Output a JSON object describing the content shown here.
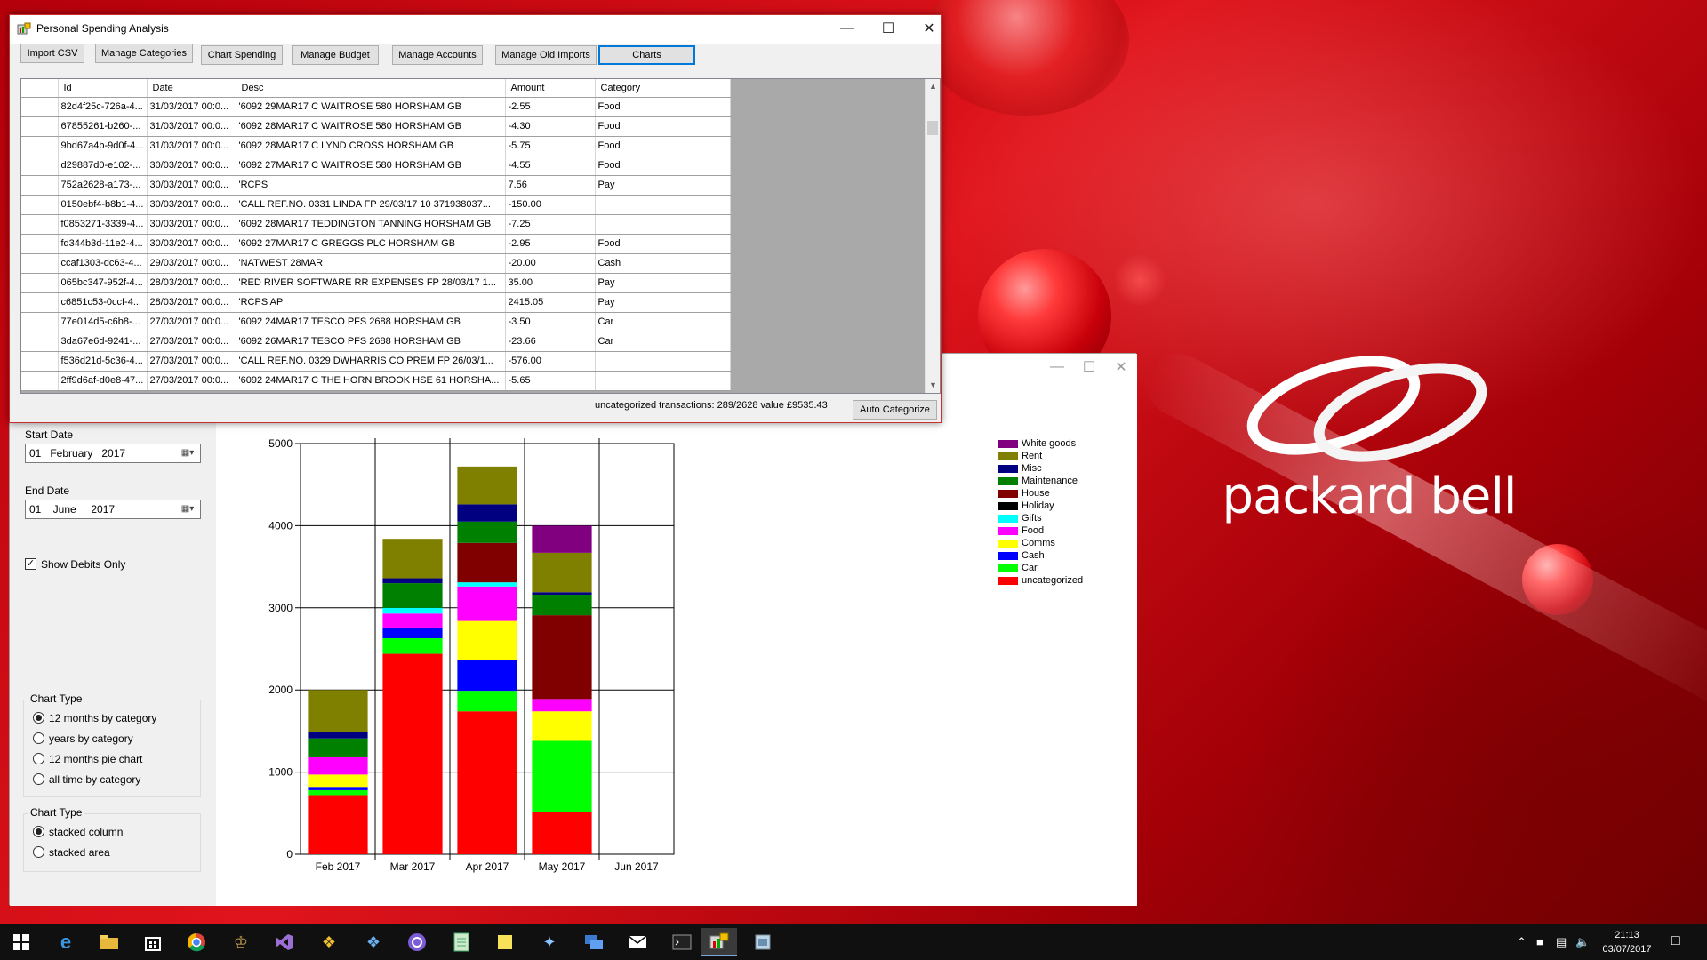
{
  "main_window": {
    "title": "Personal Spending Analysis",
    "toolbar": [
      "Import CSV",
      "Manage Categories",
      "Chart Spending",
      "Manage Budget",
      "Manage Accounts",
      "Manage Old Imports",
      "Charts"
    ],
    "grid": {
      "columns": [
        "",
        "Id",
        "Date",
        "Desc",
        "Amount",
        "Category"
      ],
      "rows": [
        [
          "82d4f25c-726a-4...",
          "31/03/2017 00:0...",
          "'6092 29MAR17 C  WAITROSE 580  HORSHAM GB",
          "-2.55",
          "Food"
        ],
        [
          "67855261-b260-...",
          "31/03/2017 00:0...",
          "'6092 28MAR17 C  WAITROSE 580  HORSHAM GB",
          "-4.30",
          "Food"
        ],
        [
          "9bd67a4b-9d0f-4...",
          "31/03/2017 00:0...",
          "'6092 28MAR17 C  LYND CROSS  HORSHAM GB",
          "-5.75",
          "Food"
        ],
        [
          "d29887d0-e102-...",
          "30/03/2017 00:0...",
          "'6092 27MAR17 C  WAITROSE 580  HORSHAM GB",
          "-4.55",
          "Food"
        ],
        [
          "752a2628-a173-...",
          "30/03/2017 00:0...",
          "'RCPS",
          "7.56",
          "Pay"
        ],
        [
          "0150ebf4-b8b1-4...",
          "30/03/2017 00:0...",
          "'CALL REF.NO. 0331  LINDA  FP 29/03/17 10  371938037...",
          "-150.00",
          ""
        ],
        [
          "f0853271-3339-4...",
          "30/03/2017 00:0...",
          "'6092 28MAR17  TEDDINGTON TANNING HORSHAM GB",
          "-7.25",
          ""
        ],
        [
          "fd344b3d-11e2-4...",
          "30/03/2017 00:0...",
          "'6092 27MAR17 C  GREGGS PLC  HORSHAM GB",
          "-2.95",
          "Food"
        ],
        [
          "ccaf1303-dc63-4...",
          "29/03/2017 00:0...",
          "'NATWEST 28MAR",
          "-20.00",
          "Cash"
        ],
        [
          "065bc347-952f-4...",
          "28/03/2017 00:0...",
          "'RED RIVER SOFTWARE RR EXPENSES  FP 28/03/17 1...",
          "35.00",
          "Pay"
        ],
        [
          "c6851c53-0ccf-4...",
          "28/03/2017 00:0...",
          "'RCPS AP",
          "2415.05",
          "Pay"
        ],
        [
          "77e014d5-c6b8-...",
          "27/03/2017 00:0...",
          "'6092 24MAR17  TESCO PFS 2688  HORSHAM GB",
          "-3.50",
          "Car"
        ],
        [
          "3da67e6d-9241-...",
          "27/03/2017 00:0...",
          "'6092 26MAR17  TESCO PFS 2688  HORSHAM GB",
          "-23.66",
          "Car"
        ],
        [
          "f536d21d-5c36-4...",
          "27/03/2017 00:0...",
          "'CALL REF.NO. 0329  DWHARRIS CO PREM  FP 26/03/1...",
          "-576.00",
          ""
        ],
        [
          "2ff9d6af-d0e8-47...",
          "27/03/2017 00:0...",
          "'6092 24MAR17 C  THE HORN BROOK HSE 61  HORSHA...",
          "-5.65",
          ""
        ]
      ]
    },
    "status": "uncategorized transactions: 289/2628 value £9535.43",
    "auto_categorize": "Auto Categorize"
  },
  "chart_window": {
    "start_date_label": "Start Date",
    "start_date": "01   February   2017",
    "end_date_label": "End Date",
    "end_date": "01    June     2017",
    "show_debits": "Show Debits Only",
    "show_debits_checked": true,
    "chart_type_group1": {
      "title": "Chart Type",
      "options": [
        "12 months by category",
        "years by category",
        "12 months pie chart",
        "all time by category"
      ],
      "selected": 0
    },
    "chart_type_group2": {
      "title": "Chart Type",
      "options": [
        "stacked column",
        "stacked area"
      ],
      "selected": 0
    }
  },
  "chart_data": {
    "type": "bar",
    "stacked": true,
    "categories": [
      "Feb 2017",
      "Mar 2017",
      "Apr 2017",
      "May 2017",
      "Jun 2017"
    ],
    "ylim": [
      0,
      5000
    ],
    "yticks": [
      0,
      1000,
      2000,
      3000,
      4000,
      5000
    ],
    "grid": true,
    "legend_position": "right",
    "series": [
      {
        "name": "uncategorized",
        "color": "#ff0000",
        "values": [
          720,
          2440,
          1740,
          510,
          0
        ]
      },
      {
        "name": "Car",
        "color": "#00ff00",
        "values": [
          60,
          190,
          250,
          870,
          0
        ]
      },
      {
        "name": "Cash",
        "color": "#0000ff",
        "values": [
          40,
          130,
          370,
          0,
          0
        ]
      },
      {
        "name": "Comms",
        "color": "#ffff00",
        "values": [
          150,
          0,
          480,
          360,
          0
        ]
      },
      {
        "name": "Food",
        "color": "#ff00ff",
        "values": [
          210,
          170,
          420,
          150,
          0
        ]
      },
      {
        "name": "Gifts",
        "color": "#00ffff",
        "values": [
          0,
          70,
          50,
          0,
          0
        ]
      },
      {
        "name": "Holiday",
        "color": "#000000",
        "values": [
          0,
          0,
          0,
          0,
          0
        ]
      },
      {
        "name": "House",
        "color": "#800000",
        "values": [
          0,
          0,
          480,
          1020,
          0
        ]
      },
      {
        "name": "Maintenance",
        "color": "#008000",
        "values": [
          230,
          300,
          260,
          250,
          0
        ]
      },
      {
        "name": "Misc",
        "color": "#000080",
        "values": [
          80,
          60,
          210,
          30,
          0
        ]
      },
      {
        "name": "Rent",
        "color": "#808000",
        "values": [
          510,
          480,
          460,
          480,
          0
        ]
      },
      {
        "name": "White goods",
        "color": "#800080",
        "values": [
          0,
          0,
          0,
          330,
          0
        ]
      }
    ]
  },
  "taskbar": {
    "icons": [
      "windows-start-icon",
      "edge-icon",
      "file-explorer-icon",
      "store-icon",
      "chrome-icon",
      "game-icon",
      "visual-studio-icon",
      "git-icon",
      "git-extensions-icon",
      "app-icon",
      "notepad-icon",
      "sticky-notes-icon",
      "network-icon",
      "remote-desktop-icon",
      "mail-icon",
      "terminal-icon",
      "spending-app-icon",
      "screenshot-icon"
    ],
    "time": "21:13",
    "date": "03/07/2017"
  }
}
